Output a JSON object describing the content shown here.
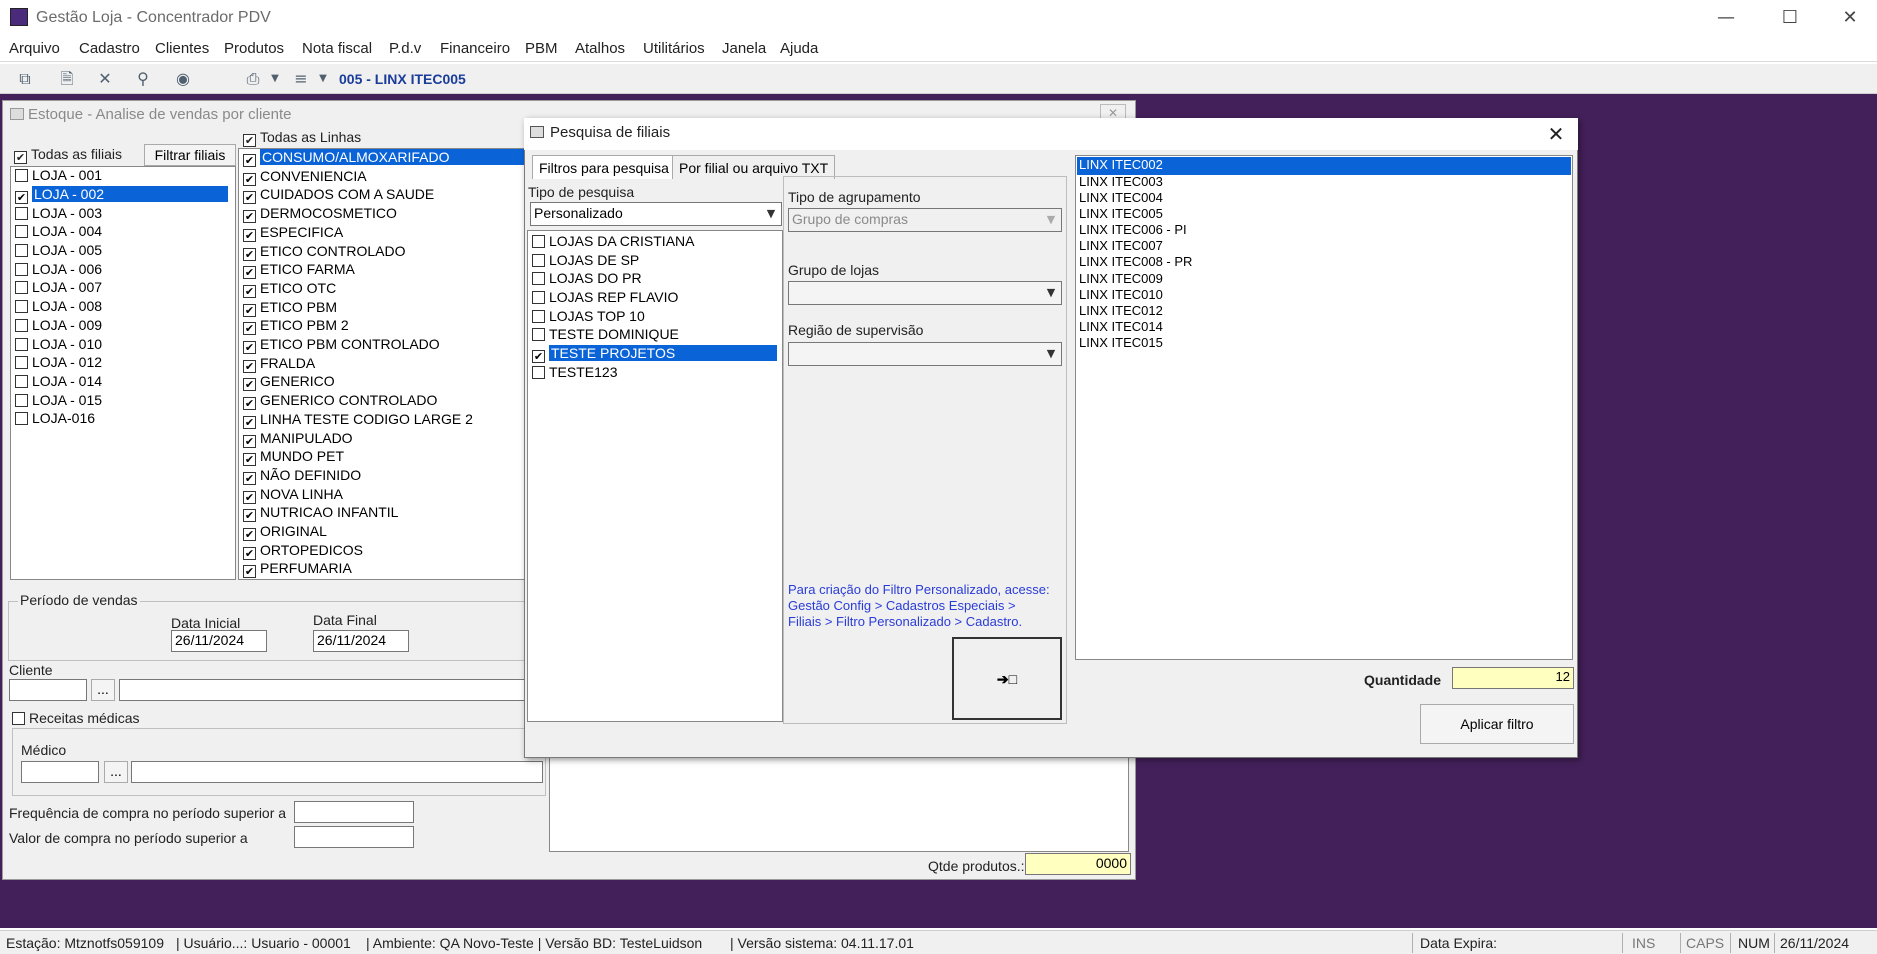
{
  "app": {
    "title": "Gestão Loja - Concentrador PDV"
  },
  "menu": [
    "Arquivo",
    "Cadastro",
    "Clientes",
    "Produtos",
    "Nota fiscal",
    "P.d.v",
    "Financeiro",
    "PBM",
    "Atalhos",
    "Utilitários",
    "Janela",
    "Ajuda"
  ],
  "toolbar": {
    "store": "005 - LINX ITEC005"
  },
  "estoque": {
    "title": "Estoque - Analise de vendas por cliente",
    "all_stores_label": "Todas as filiais",
    "filter_stores_button": "Filtrar filiais",
    "stores": [
      "LOJA - 001",
      "LOJA - 002",
      "LOJA - 003",
      "LOJA - 004",
      "LOJA - 005",
      "LOJA - 006",
      "LOJA - 007",
      "LOJA - 008",
      "LOJA - 009",
      "LOJA - 010",
      "LOJA - 012",
      "LOJA - 014",
      "LOJA - 015",
      "LOJA-016"
    ],
    "all_lines_label": "Todas as Linhas",
    "lines": [
      "CONSUMO/ALMOXARIFADO",
      "CONVENIENCIA",
      "CUIDADOS COM A SAUDE",
      "DERMOCOSMETICO",
      "ESPECIFICA",
      "ETICO CONTROLADO",
      "ETICO FARMA",
      "ETICO OTC",
      "ETICO PBM",
      "ETICO PBM 2",
      "ETICO PBM CONTROLADO",
      "FRALDA",
      "GENERICO",
      "GENERICO CONTROLADO",
      "LINHA TESTE CODIGO LARGE 2",
      "MANIPULADO",
      "MUNDO PET",
      "NÃO DEFINIDO",
      "NOVA LINHA",
      "NUTRICAO INFANTIL",
      "ORIGINAL",
      "ORTOPEDICOS",
      "PERFUMARIA"
    ],
    "period_label": "Período de vendas",
    "start_label": "Data Inicial",
    "start_value": "26/11/2024",
    "end_label": "Data Final",
    "end_value": "26/11/2024",
    "client_label": "Cliente",
    "ellipsis": "...",
    "prescriptions_label": "Receitas médicas",
    "doctor_label": "Médico",
    "freq_label": "Frequência de compra no período superior a",
    "value_label": "Valor de compra no período superior a",
    "qty_products_label": "Qtde produtos.:",
    "qty_products_value": "0000"
  },
  "dialog": {
    "title": "Pesquisa de filiais",
    "tab_filters": "Filtros para pesquisa",
    "tab_file": "Por filial ou arquivo TXT",
    "search_type_label": "Tipo de pesquisa",
    "search_type_value": "Personalizado",
    "filters": [
      "LOJAS DA CRISTIANA",
      "LOJAS DE SP",
      "LOJAS DO PR",
      "LOJAS REP FLAVIO",
      "LOJAS TOP 10",
      "TESTE DOMINIQUE",
      "TESTE PROJETOS",
      "TESTE123"
    ],
    "grouping_label": "Tipo de agrupamento",
    "grouping_value": "Grupo de compras",
    "store_group_label": "Grupo de lojas",
    "region_label": "Região de supervisão",
    "help_text_1": "Para criação do Filtro Personalizado, acesse:",
    "help_text_2": "Gestão Config > Cadastros Especiais >",
    "help_text_3": "Filiais > Filtro Personalizado > Cadastro.",
    "results": [
      "LINX ITEC002",
      "LINX ITEC003",
      "LINX ITEC004",
      "LINX ITEC005",
      "LINX ITEC006 - PI",
      "LINX ITEC007",
      "LINX ITEC008 - PR",
      "LINX ITEC009",
      "LINX ITEC010",
      "LINX ITEC012",
      "LINX ITEC014",
      "LINX ITEC015"
    ],
    "quantity_label": "Quantidade",
    "quantity_value": "12",
    "apply_button": "Aplicar filtro"
  },
  "status": {
    "station": "Estação: Mtznotfs059109",
    "user": "| Usuário...: Usuario - 00001",
    "env": "| Ambiente: QA Novo-Teste | Versão BD: TesteLuidson",
    "version": "| Versão sistema: 04.11.17.01",
    "expire": "Data Expira:",
    "ins": "INS",
    "caps": "CAPS",
    "num": "NUM",
    "date": "26/11/2024"
  },
  "colors": {
    "desktop": "#43205a",
    "selection": "#0a64d8",
    "link_text": "#2a3cd8",
    "highlight_field": "#ffffc0"
  }
}
